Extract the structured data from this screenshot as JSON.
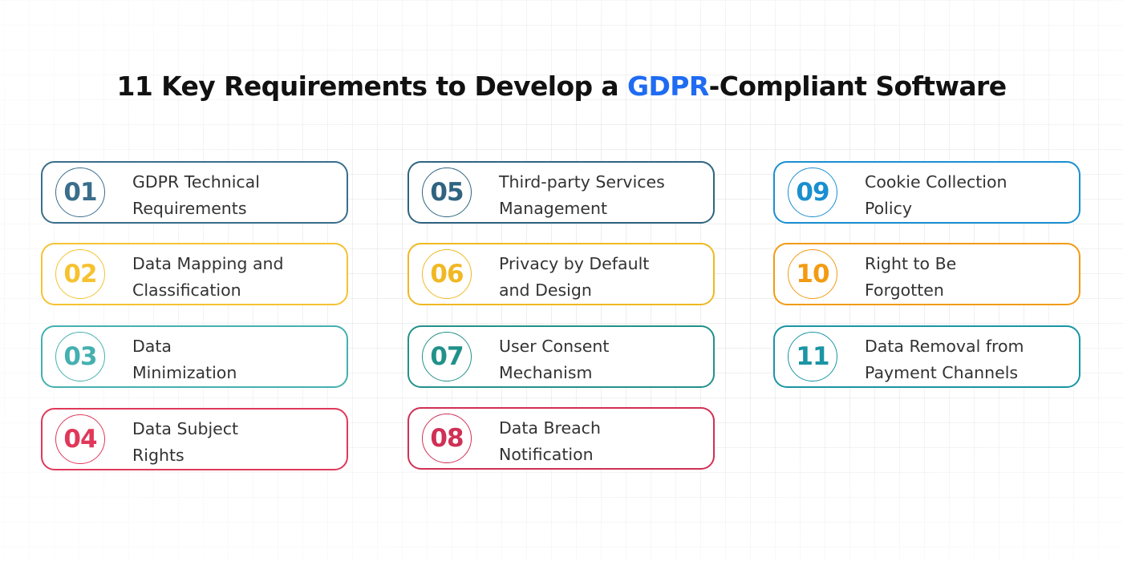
{
  "title": {
    "prefix": "11 Key Requirements to Develop a ",
    "highlight": "GDPR",
    "suffix": "-Compliant Software",
    "highlight_color": "#1f6bf2"
  },
  "items": [
    {
      "number": "01",
      "line1": "GDPR Technical",
      "line2": "Requirements",
      "color": "#3a6e8c"
    },
    {
      "number": "02",
      "line1": "Data Mapping and",
      "line2": "Classification",
      "color": "#f5c232"
    },
    {
      "number": "03",
      "line1": "Data",
      "line2": "Minimization",
      "color": "#45b0b0"
    },
    {
      "number": "04",
      "line1": "Data Subject",
      "line2": "Rights",
      "color": "#e0385a"
    },
    {
      "number": "05",
      "line1": "Third-party Services",
      "line2": "Management",
      "color": "#2f6480"
    },
    {
      "number": "06",
      "line1": "Privacy by Default",
      "line2": "and Design",
      "color": "#f0b822"
    },
    {
      "number": "07",
      "line1": "User Consent",
      "line2": "Mechanism",
      "color": "#22918a"
    },
    {
      "number": "08",
      "line1": "Data Breach",
      "line2": "Notification",
      "color": "#d03055"
    },
    {
      "number": "09",
      "line1": "Cookie Collection",
      "line2": "Policy",
      "color": "#1a8fd0"
    },
    {
      "number": "10",
      "line1": "Right to Be",
      "line2": "Forgotten",
      "color": "#f29b12"
    },
    {
      "number": "11",
      "line1": "Data Removal from",
      "line2": "Payment Channels",
      "color": "#1a95a5"
    }
  ]
}
